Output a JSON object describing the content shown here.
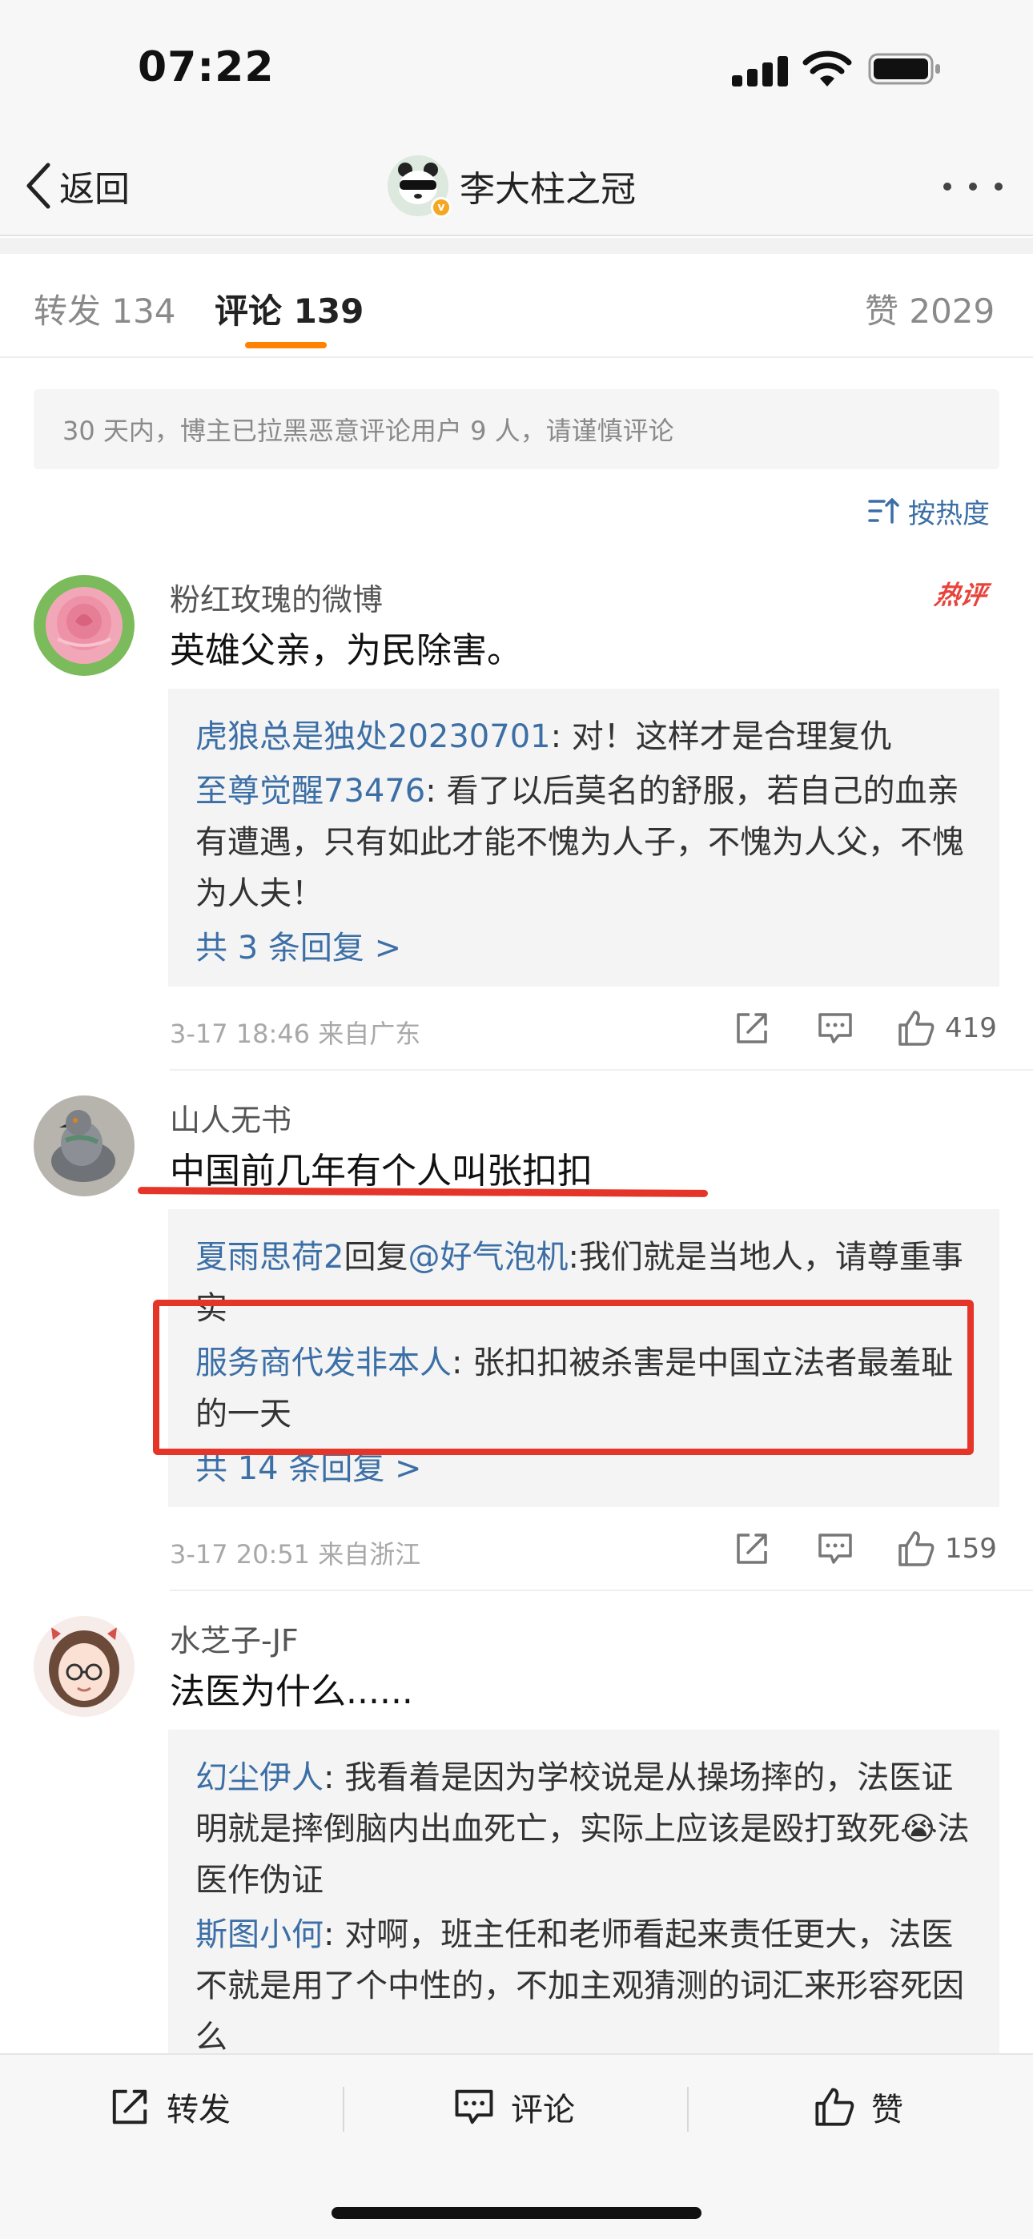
{
  "status_bar": {
    "time": "07:22"
  },
  "nav": {
    "back_label": "返回",
    "title": "李大柱之冠",
    "verified_badge": "v"
  },
  "tabs": [
    {
      "label": "转发 134"
    },
    {
      "label": "评论 139"
    },
    {
      "label": "赞 2029"
    }
  ],
  "notice": "30 天内，博主已拉黑恶意评论用户 9 人，请谨慎评论",
  "sort_label": "按热度",
  "comments": [
    {
      "user": "粉红玫瑰的微博",
      "badge": "热评",
      "text": "英雄父亲，为民除害。",
      "replies": [
        {
          "user": "虎狼总是独处20230701",
          "text": ": 对！这样才是合理复仇"
        },
        {
          "user": "至尊觉醒73476",
          "text": ": 看了以后莫名的舒服，若自己的血亲有遭遇，只有如此才能不愧为人子，不愧为人父，不愧为人夫！"
        }
      ],
      "more_replies": "共 3 条回复 >",
      "meta": "3-17 18:46  来自广东",
      "likes": "419"
    },
    {
      "user": "山人无书",
      "text": "中国前几年有个人叫张扣扣",
      "replies": [
        {
          "user": "夏雨思荷2",
          "mid": "回复",
          "mention": "@好气泡机",
          "text": ":我们就是当地人，请尊重事实"
        },
        {
          "user": "服务商代发非本人",
          "text": ": 张扣扣被杀害是中国立法者最羞耻的一天"
        }
      ],
      "more_replies": "共 14 条回复 >",
      "meta": "3-17 20:51  来自浙江",
      "likes": "159"
    },
    {
      "user": "水芝子-JF",
      "text": "法医为什么......",
      "replies": [
        {
          "user": "幻尘伊人",
          "text": ": 我看着是因为学校说是从操场摔的，法医证明就是摔倒脑内出血死亡，实际上应该是殴打致死😭法医作伪证"
        },
        {
          "user": "斯图小何",
          "text": ": 对啊，班主任和老师看起来责任更大，法医不就是用了个中性的，不加主观猜测的词汇来形容死因么"
        }
      ]
    }
  ],
  "bottom_bar": {
    "repost": "转发",
    "comment": "评论",
    "like": "赞"
  },
  "colors": {
    "accent": "#ff8200",
    "link": "#3c6fa6",
    "annotation": "#e53428"
  }
}
